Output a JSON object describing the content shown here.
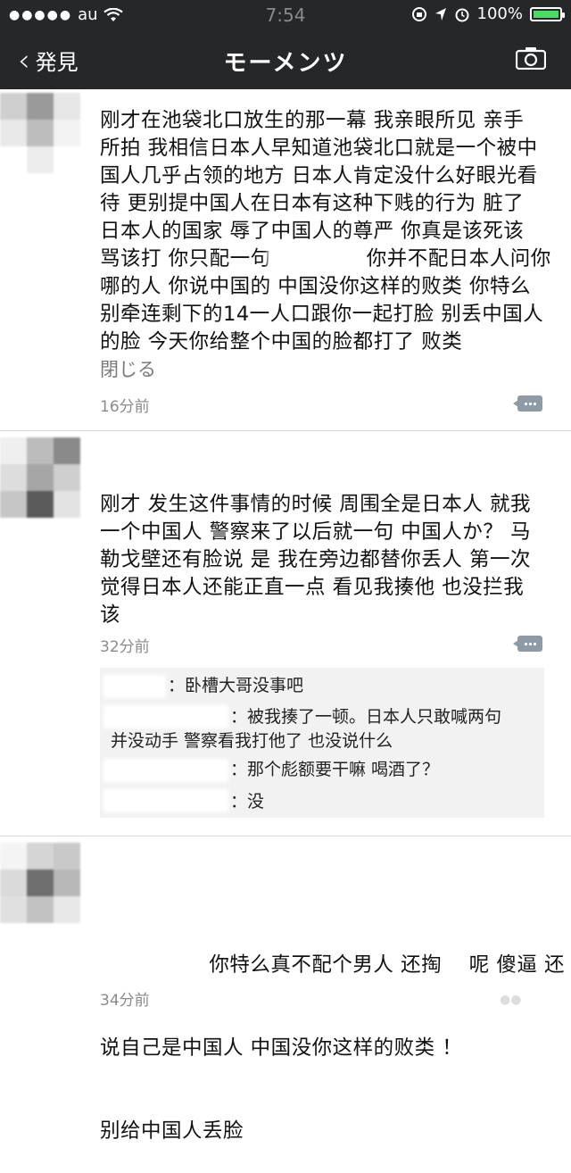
{
  "status": {
    "carrier": "au",
    "time": "7:54",
    "battery": "100%",
    "signal_dots": "●●●●●"
  },
  "nav": {
    "back_label": "発見",
    "title": "モーメンツ",
    "camera_icon": "camera-icon"
  },
  "posts": [
    {
      "lines": [
        "刚才在池袋北口放生的那一幕 我亲眼所见 亲手",
        "所拍 我相信日本人早知道池袋北口就是一个被中",
        "国人几乎占领的地方 日本人肯定没什么好眼光看",
        "待 更别提中国人在日本有这种下贱的行为 脏了",
        "日本人的国家 辱了中国人的尊严 你真是该死该",
        "骂该打 你只配一句              你并不配日本人问你",
        "哪的人 你说中国的 中国没你这样的败类 你特么",
        "别牵连剩下的14一人口跟你一起打脸 别丢中国人",
        "的脸 今天你给整个中国的脸都打了 败类"
      ],
      "close_label": "閉じる",
      "time": "16分前"
    },
    {
      "lines": [
        "刚才 发生这件事情的时候 周围全是日本人 就我",
        "一个中国人 警察来了以后就一句 中国人か？ 马",
        "勒戈壁还有脸说 是 我在旁边都替你丢人 第一次",
        "觉得日本人还能正直一点 看见我揍他 也没拦我",
        "该"
      ],
      "time": "32分前",
      "replies": [
        {
          "text": "：卧槽大哥没事吧"
        },
        {
          "text": "：被我揍了一顿。日本人只敢喊两句"
        },
        {
          "text": "并没动手 警察看我打他了 也没说什么"
        },
        {
          "text": "：那个彪额要干嘛 喝酒了？"
        },
        {
          "text": "：没"
        }
      ]
    },
    {
      "lines": [
        "                你特么真不配个男人 还掏    呢 傻逼 还",
        "说自己是中国人 中国没你这样的败类 ！",
        "别给中国人丢脸"
      ],
      "time": "34分前"
    }
  ]
}
